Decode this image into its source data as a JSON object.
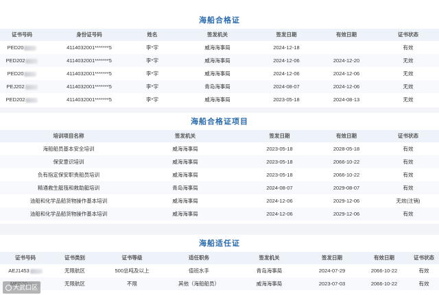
{
  "s1": {
    "title": "海船合格证",
    "headers": [
      "证书号码",
      "身份证号码",
      "姓名",
      "签发机关",
      "签发日期",
      "有效日期",
      "证书状态"
    ],
    "rows": [
      [
        "PED20",
        "4114032001*******5",
        "李*宇",
        "威海海事局",
        "2024-12-18",
        "",
        "有效"
      ],
      [
        "PED202",
        "4114032001*******5",
        "李*宇",
        "威海海事局",
        "2024-12-06",
        "2024-12-20",
        "无效"
      ],
      [
        "PED20",
        "4114032001*******5",
        "李*宇",
        "威海海事局",
        "2024-12-06",
        "2024-12-06",
        "无效"
      ],
      [
        "PEJ202",
        "4114032001*******5",
        "李*宇",
        "青岛海事局",
        "2024-08-07",
        "2024-12-06",
        "无效"
      ],
      [
        "PED202",
        "4114032001*******5",
        "李*宇",
        "威海海事局",
        "2023-05-18",
        "2024-08-13",
        "无效"
      ]
    ]
  },
  "s2": {
    "title": "海船合格证项目",
    "headers": [
      "培训项目名称",
      "签发机关",
      "签发日期",
      "有效日期",
      "证书状态"
    ],
    "rows": [
      [
        "海船船员基本安全培训",
        "威海海事局",
        "2023-05-18",
        "2028-05-18",
        "有效"
      ],
      [
        "保安意识培训",
        "威海海事局",
        "2023-05-18",
        "2066-10-22",
        "有效"
      ],
      [
        "负有指定保安职责船员培训",
        "威海海事局",
        "2023-05-18",
        "2066-10-22",
        "有效"
      ],
      [
        "精通救生艇筏和救助艇培训",
        "青岛海事局",
        "2024-08-07",
        "2029-08-07",
        "有效"
      ],
      [
        "油船和化学品船货物操作基本培训",
        "威海海事局",
        "2024-12-06",
        "2029-12-06",
        "无效(注销)"
      ],
      [
        "油船和化学品船货物操作基本培训",
        "威海海事局",
        "2024-12-06",
        "2029-12-06",
        "有效"
      ]
    ]
  },
  "s3": {
    "title": "海船适任证",
    "headers": [
      "证书号码",
      "证书类别",
      "证书等级",
      "适任职务",
      "签发机关",
      "签发日期",
      "有效日期",
      "证书状态"
    ],
    "rows": [
      [
        "AEJ1453",
        "无限航区",
        "500总吨及以上",
        "值班水手",
        "青岛海事局",
        "2024-07-29",
        "2066-10-22",
        "有效"
      ],
      [
        "MED20",
        "无限航区",
        "不限",
        "其他（海船船员）",
        "威海海事局",
        "2023-07-03",
        "2066-10-22",
        "有效"
      ]
    ]
  },
  "watermark": "大武口区"
}
